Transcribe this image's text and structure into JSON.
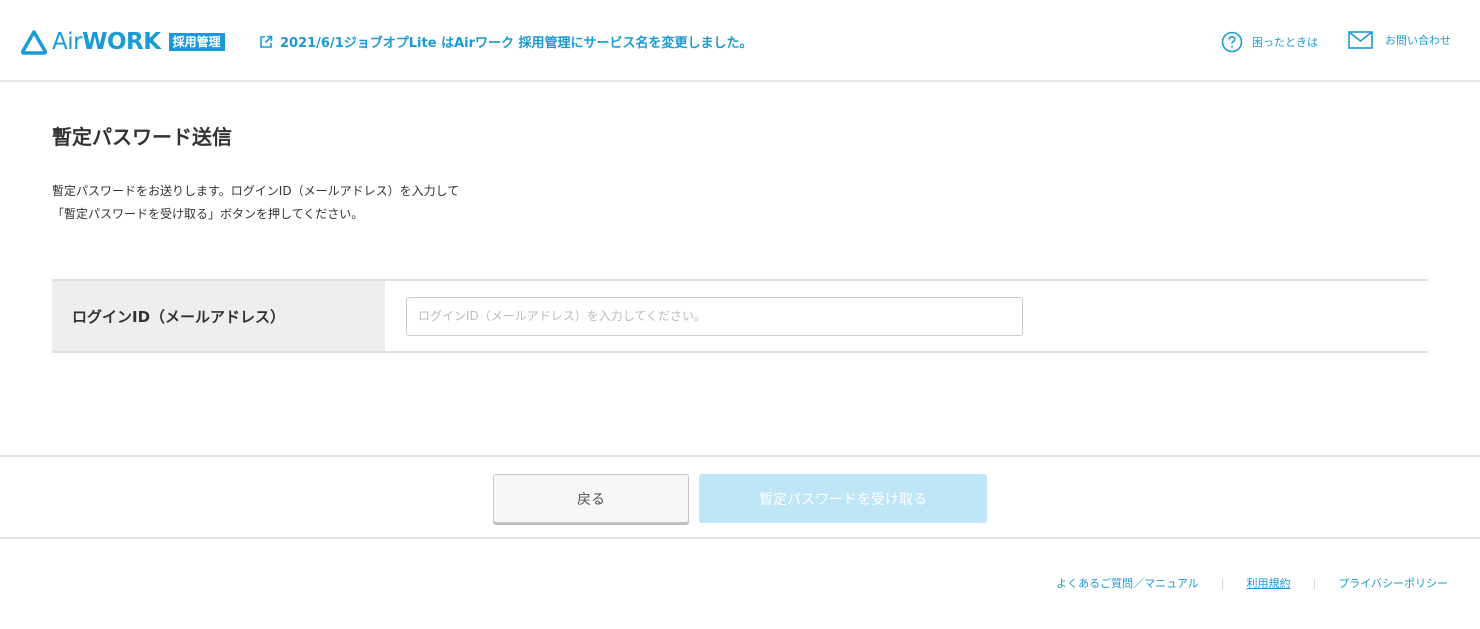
{
  "header": {
    "logo_text_prefix": "Air",
    "logo_text_suffix": "WORK",
    "logo_badge": "採用管理",
    "notice": "2021/6/1ジョブオプLite はAirワーク 採用管理にサービス名を変更しました。",
    "help_label": "困ったときは",
    "contact_label": "お問い合わせ"
  },
  "main": {
    "title": "暫定パスワード送信",
    "description_line1": "暫定パスワードをお送りします。ログインID（メールアドレス）を入力して",
    "description_line2": "「暫定パスワードを受け取る」ボタンを押してください。",
    "form": {
      "label": "ログインID（メールアドレス）",
      "value": "",
      "placeholder": "ログインID（メールアドレス）を入力してください。"
    }
  },
  "buttons": {
    "back_label": "戻る",
    "submit_label": "暫定パスワードを受け取る"
  },
  "footer": {
    "links": [
      "よくあるご質問／マニュアル",
      "利用規約",
      "プライバシーポリシー"
    ],
    "separator": "|"
  },
  "colors": {
    "brand": "#1a9ad6",
    "submit_disabled": "#bfe6f6"
  }
}
